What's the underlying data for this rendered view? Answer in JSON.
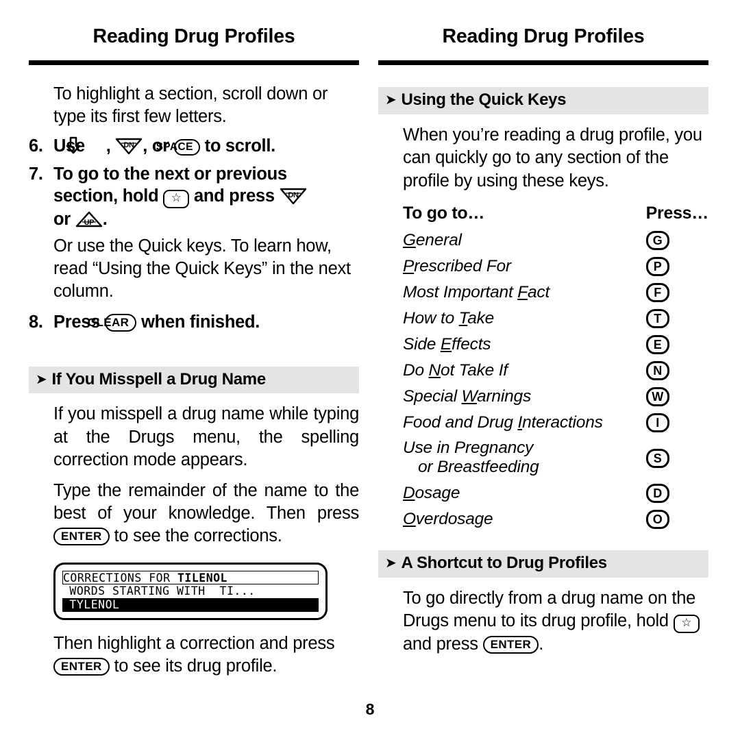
{
  "document": {
    "page_number": "8",
    "left_header": "Reading Drug Profiles",
    "right_header": "Reading Drug Profiles"
  },
  "left_column": {
    "intro_paragraph": "To highlight a section, scroll down or type its first few letters.",
    "step6": {
      "number": "6.",
      "text_a": "Use",
      "key_arrow_down": "down-arrow",
      "sep1": ",",
      "key_dn": "DN",
      "sep2": ", or",
      "key_space": "SPACE",
      "text_b": "to scroll."
    },
    "step7": {
      "number": "7.",
      "line1": "To go to the next or previous",
      "line2_a": "section, hold",
      "key_star": "☆",
      "line2_b": "and press",
      "key_dn": "DN",
      "line3_a": "or",
      "key_up": "UP",
      "line3_b": "."
    },
    "step7_note": "Or use the Quick keys. To learn how, read “Using the Quick Keys” in the next column.",
    "step8": {
      "number": "8.",
      "text_a": "Press",
      "key_clear": "CLEAR",
      "text_b": "when finished."
    },
    "misspell_section": {
      "heading": "If You Misspell a Drug Name",
      "arrow": "➤",
      "paragraph1": "If you misspell a drug name while typing at the Drugs menu, the spelling correction mode appears.",
      "paragraph2_a": "Type the remainder of the name to the best of your knowledge. Then press",
      "key_enter": "ENTER",
      "paragraph2_b": "to see the corrections.",
      "lcd": {
        "line1_prefix": "CORRECTIONS FOR ",
        "line1_bold": "TILENOL",
        "line2": " WORDS STARTING WITH  TI...",
        "line3": " TYLENOL"
      },
      "paragraph3_a": "Then highlight a correction and press",
      "key_enter_2": "ENTER",
      "paragraph3_b": "to see its drug profile."
    }
  },
  "right_column": {
    "quick_keys_section": {
      "heading": "Using the Quick Keys",
      "arrow": "➤",
      "paragraph": "When you’re reading a drug profile, you can quickly go to any section of the profile by using these keys."
    },
    "key_table": {
      "header_left": "To go to…",
      "header_right": "Press…",
      "rows": [
        {
          "label_before": "",
          "label_underlined": "G",
          "label_after": "eneral",
          "key": "G"
        },
        {
          "label_before": "",
          "label_underlined": "P",
          "label_after": "rescribed For",
          "key": "P"
        },
        {
          "label_before": "Most Important ",
          "label_underlined": "F",
          "label_after": "act",
          "key": "F"
        },
        {
          "label_before": "How to ",
          "label_underlined": "T",
          "label_after": "ake",
          "key": "T"
        },
        {
          "label_before": "Side ",
          "label_underlined": "E",
          "label_after": "ffects",
          "key": "E"
        },
        {
          "label_before": "Do ",
          "label_underlined": "N",
          "label_after": "ot Take If",
          "key": "N"
        },
        {
          "label_before": "Special ",
          "label_underlined": "W",
          "label_after": "arnings",
          "key": "W"
        },
        {
          "label_before": "Food and Drug ",
          "label_underlined": "I",
          "label_after": "nteractions",
          "key": "I"
        },
        {
          "label_before": "Use in Pregnancy",
          "label_underlined": "",
          "label_after": "",
          "label_line2": "or Breastfeeding",
          "key": "S"
        },
        {
          "label_before": "",
          "label_underlined": "D",
          "label_after": "osage",
          "key": "D"
        },
        {
          "label_before": "",
          "label_underlined": "O",
          "label_after": "verdosage",
          "key": "O"
        }
      ]
    },
    "shortcut_section": {
      "heading": "A Shortcut to Drug Profiles",
      "arrow": "➤",
      "paragraph_a": "To go directly from a drug name on the Drugs menu to its drug profile, hold",
      "key_star": "☆",
      "paragraph_b": "and press",
      "key_enter": "ENTER",
      "paragraph_c": "."
    }
  },
  "colors": {
    "section_band": "#e4e4e4",
    "rule": "#000000",
    "text": "#000000",
    "lcd_background": "#000000"
  }
}
